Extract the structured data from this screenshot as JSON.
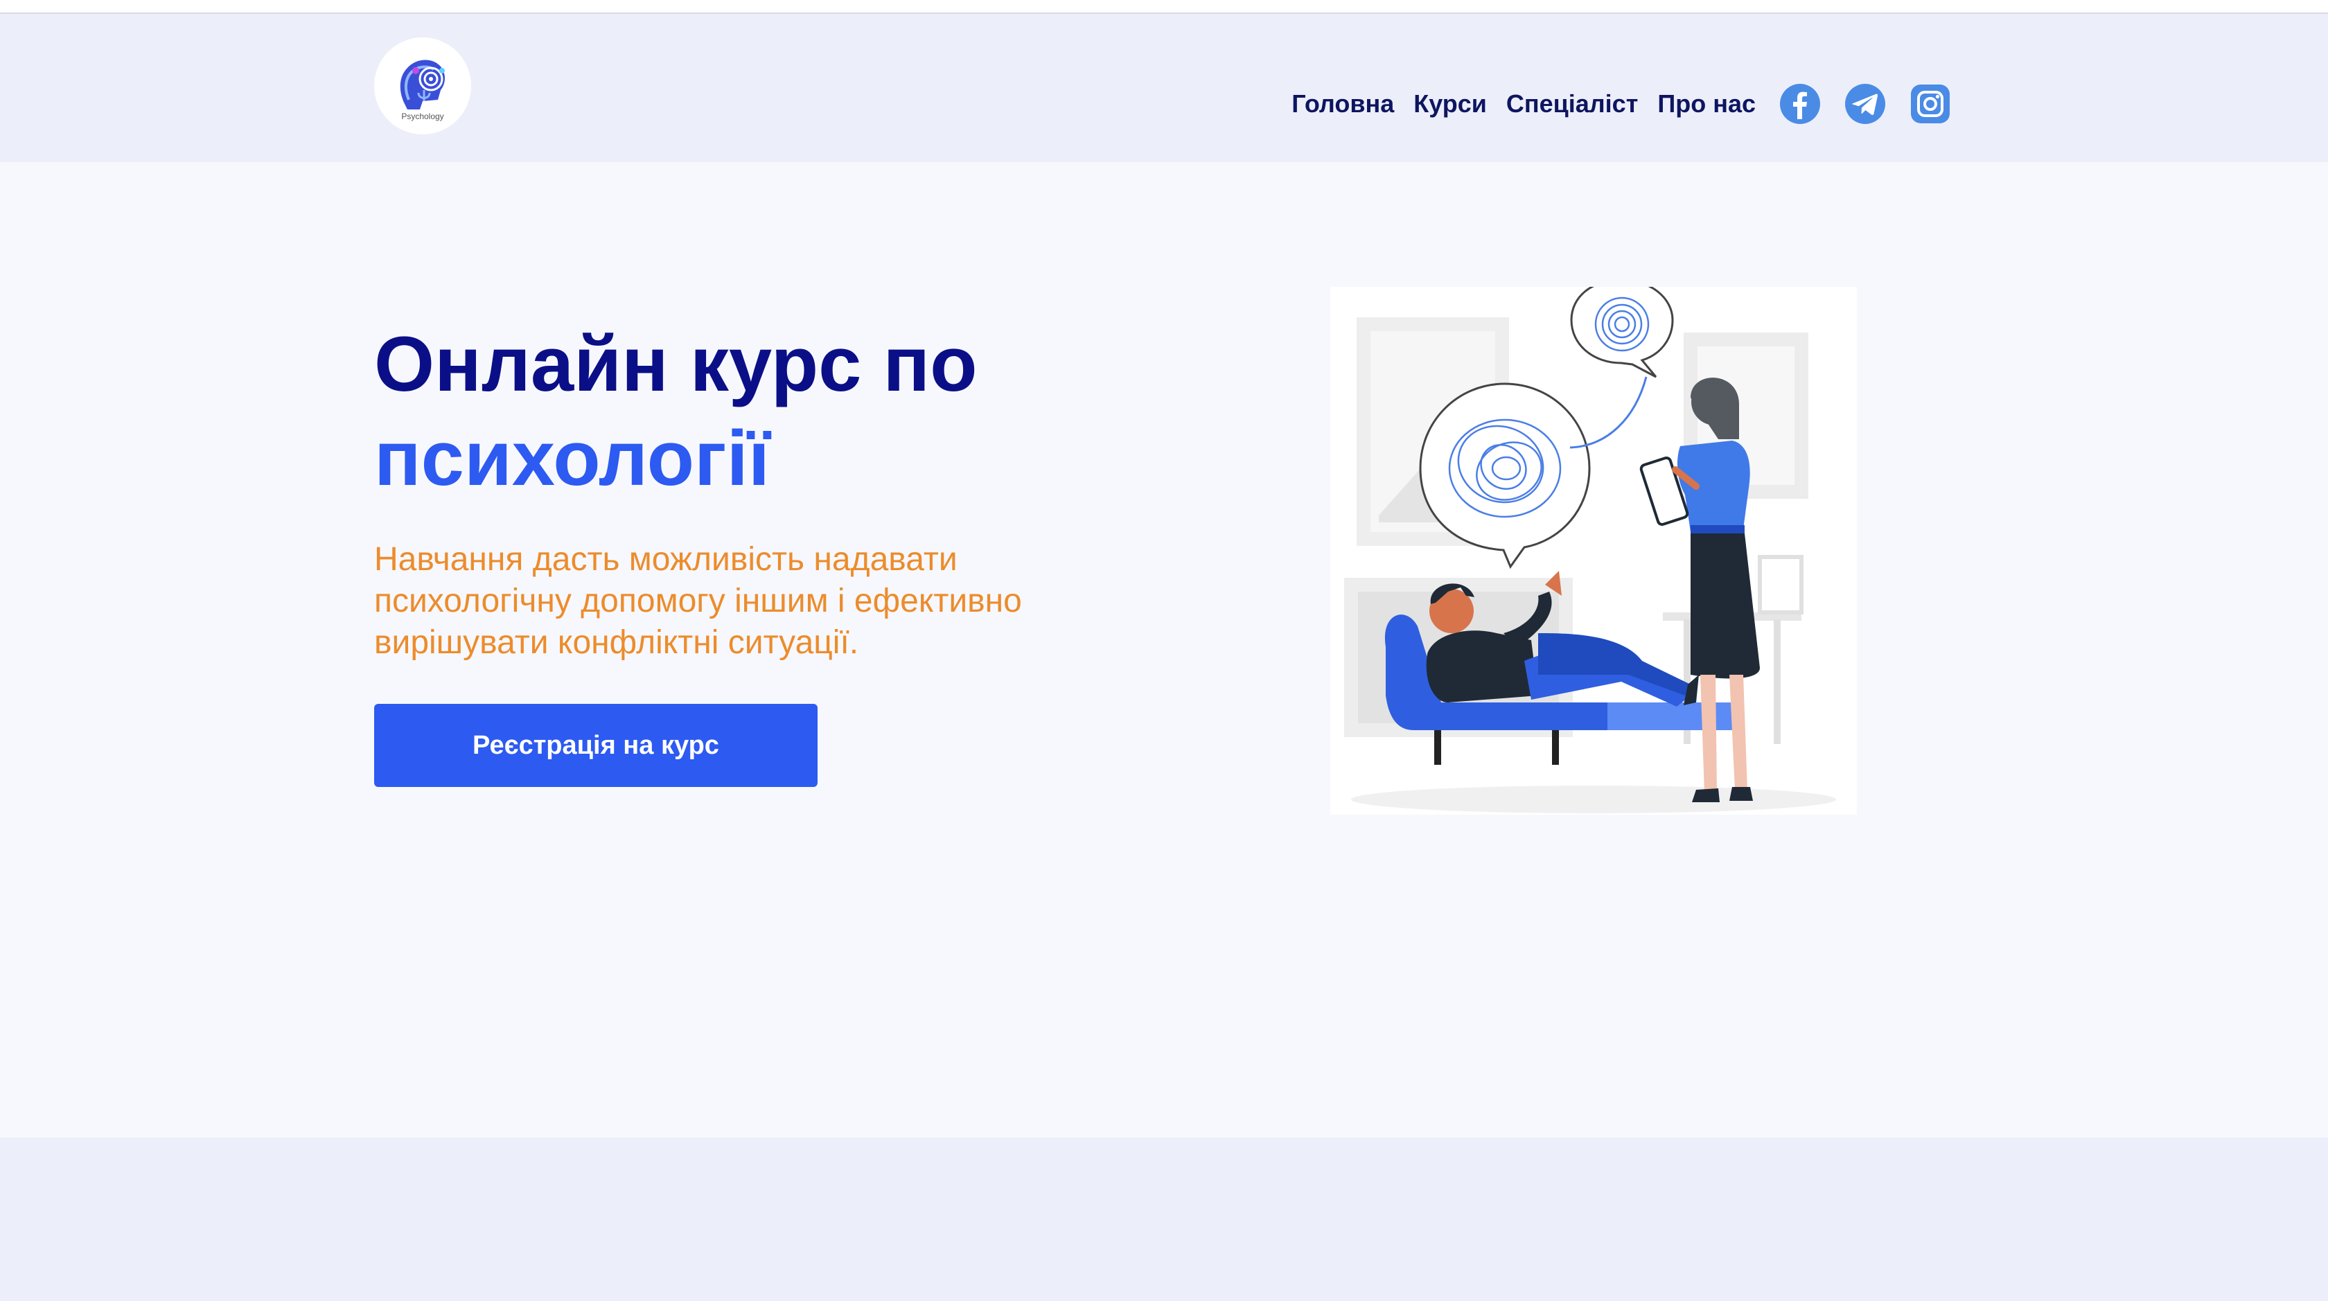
{
  "header": {
    "logo_text": "Psychology",
    "nav": [
      {
        "label": "Головна"
      },
      {
        "label": "Курси"
      },
      {
        "label": "Спеціаліст"
      },
      {
        "label": "Про нас"
      }
    ],
    "social": [
      {
        "icon": "facebook-icon"
      },
      {
        "icon": "telegram-icon"
      },
      {
        "icon": "instagram-icon"
      }
    ]
  },
  "hero": {
    "title_line1": "Онлайн курс по",
    "title_line2": "психології",
    "subtitle": "Навчання дасть можливість надавати психологічну допомогу іншим і ефективно вирішувати конфліктні ситуації.",
    "cta_label": "Реєстрація на курс"
  },
  "colors": {
    "header_bg": "#eceff9",
    "hero_bg": "#f7f8fd",
    "title_dark": "#0b0f87",
    "title_accent": "#2d5af1",
    "subtitle": "#ec8c2c",
    "cta_bg": "#2d5af1",
    "social_icon": "#4a8be6"
  }
}
